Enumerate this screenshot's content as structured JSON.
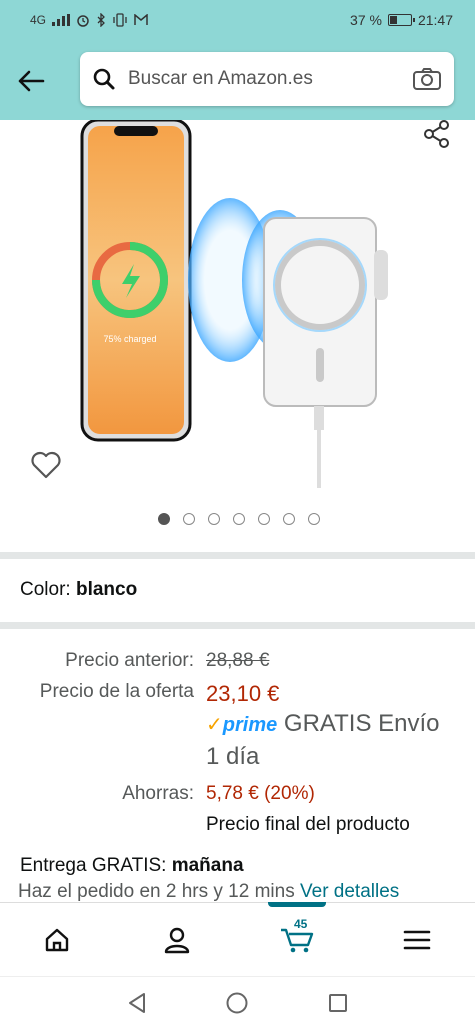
{
  "status_bar": {
    "network": "4G",
    "battery_text": "37 %",
    "battery_level": 0.37,
    "time": "21:47"
  },
  "header": {
    "back_icon": "arrow-left-icon",
    "search_placeholder": "Buscar en Amazon.es",
    "search_icon": "search-icon",
    "camera_icon": "camera-icon"
  },
  "gallery": {
    "image_count": 7,
    "active_index": 0,
    "image_caption": "75% charged"
  },
  "color": {
    "label": "Color:",
    "value": "blanco"
  },
  "pricing": {
    "previous_label": "Precio anterior:",
    "previous_value": "28,88 €",
    "deal_label": "Precio de la oferta",
    "deal_value": "23,10 €",
    "prime_check": "✓",
    "prime_word": "prime",
    "shipping": "GRATIS Envío",
    "shipping_time": "1 día",
    "savings_label": "Ahorras:",
    "savings_value": "5,78 € (20%)",
    "final_note": "Precio final del producto"
  },
  "delivery": {
    "prefix": "Entrega GRATIS:",
    "day": "mañana",
    "order_by": "Haz el pedido en 2 hrs y 12 mins",
    "details_link": "Ver detalles"
  },
  "bottom_nav": {
    "cart_count": "45",
    "items": [
      "home-icon",
      "account-icon",
      "cart-icon",
      "menu-icon"
    ]
  },
  "colors": {
    "header_bg": "#8ed7d5",
    "price_red": "#b12704",
    "link_teal": "#007185",
    "prime_blue": "#1a98ff"
  }
}
